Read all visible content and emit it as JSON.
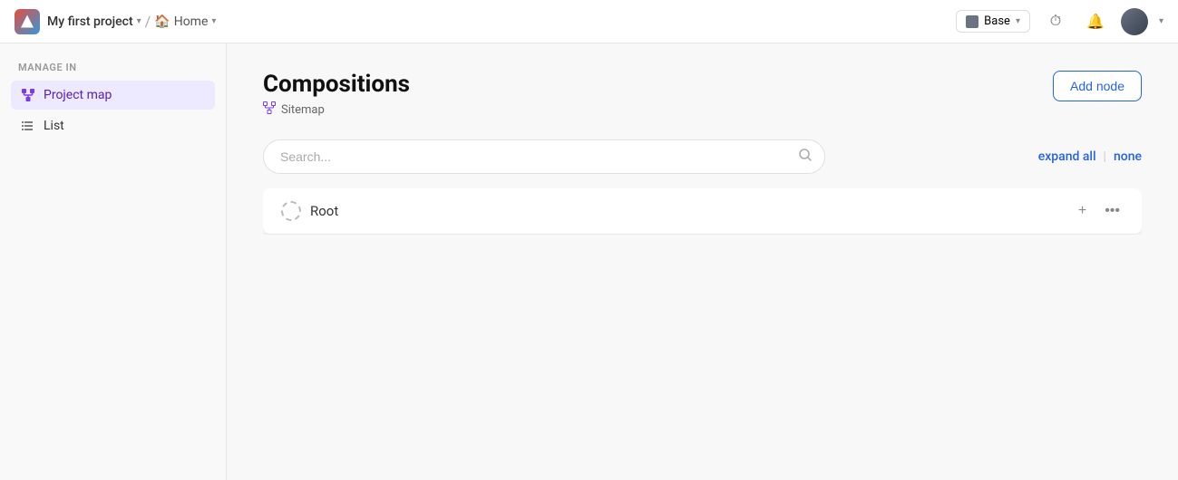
{
  "nav": {
    "project_name": "My first project",
    "project_chevron": "▾",
    "separator": "/",
    "home_label": "Home",
    "home_chevron": "▾",
    "base_label": "Base",
    "base_chevron": "▾",
    "history_icon": "⏱",
    "notification_icon": "🔔"
  },
  "sidebar": {
    "section_label": "Manage in",
    "items": [
      {
        "id": "project-map",
        "label": "Project map",
        "active": true
      },
      {
        "id": "list",
        "label": "List",
        "active": false
      }
    ]
  },
  "main": {
    "title": "Compositions",
    "breadcrumb_icon": "⊞",
    "breadcrumb_label": "Sitemap",
    "add_node_label": "Add node",
    "search_placeholder": "Search...",
    "expand_all_label": "expand all",
    "expand_separator": "|",
    "none_label": "none",
    "tree": {
      "root_label": "Root"
    }
  }
}
